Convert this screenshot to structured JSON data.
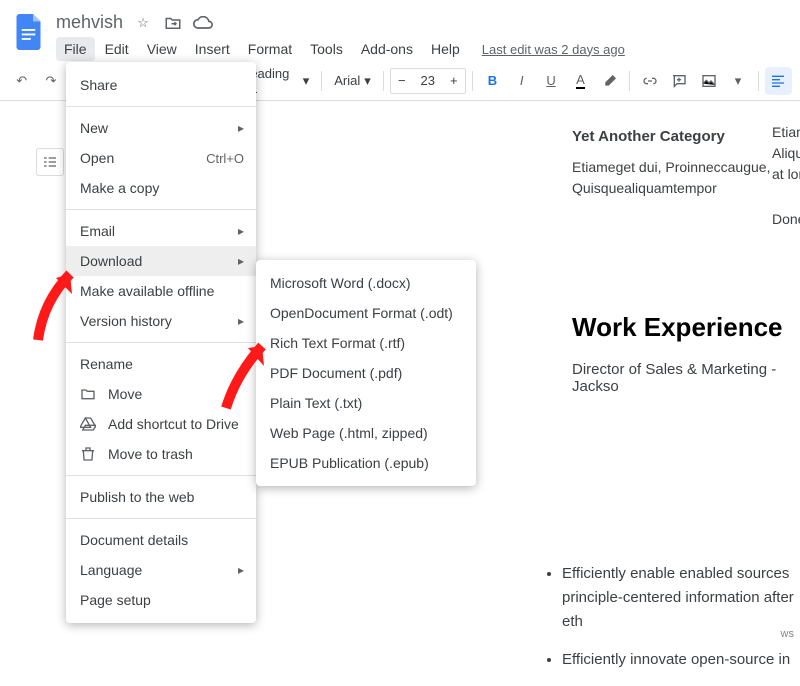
{
  "doc": {
    "title": "mehvish"
  },
  "menubar": [
    "File",
    "Edit",
    "View",
    "Insert",
    "Format",
    "Tools",
    "Add-ons",
    "Help"
  ],
  "last_edit": "Last edit was 2 days ago",
  "toolbar": {
    "heading": "eading 1",
    "font": "Arial",
    "fontsize": "23"
  },
  "file_menu": {
    "share": "Share",
    "new": "New",
    "open": "Open",
    "open_shortcut": "Ctrl+O",
    "make_copy": "Make a copy",
    "email": "Email",
    "download": "Download",
    "make_offline": "Make available offline",
    "version_history": "Version history",
    "rename": "Rename",
    "move": "Move",
    "add_shortcut": "Add shortcut to Drive",
    "move_to_trash": "Move to trash",
    "publish": "Publish to the web",
    "doc_details": "Document details",
    "language": "Language",
    "page_setup": "Page setup"
  },
  "download_menu": {
    "docx": "Microsoft Word (.docx)",
    "odt": "OpenDocument Format (.odt)",
    "rtf": "Rich Text Format (.rtf)",
    "pdf": "PDF Document (.pdf)",
    "txt": "Plain Text (.txt)",
    "html": "Web Page (.html, zipped)",
    "epub": "EPUB Publication (.epub)"
  },
  "document": {
    "category_title": "Yet Another Category",
    "category_body": "Etiameget dui, Proinneccaugue, Quisquealiquamtempor",
    "side1": "Etiame\nAliquan\nat loren",
    "side2": "Donecl",
    "work_exp_title": "Work Experience",
    "work_exp_sub": "Director of Sales & Marketing - Jackso",
    "bullet1": "Efficiently enable enabled sources principle-centered information after eth",
    "bullet2": "Efficiently innovate open-source in"
  },
  "watermark": "ws"
}
